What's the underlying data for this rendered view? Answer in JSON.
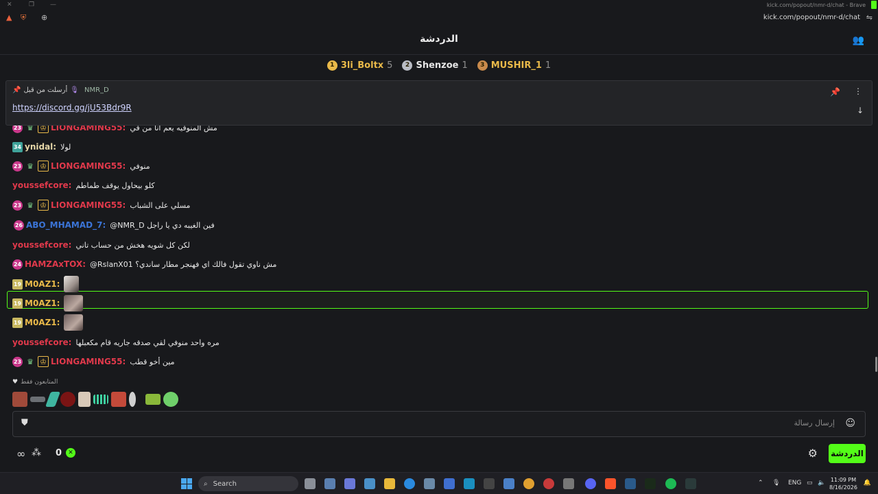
{
  "browser": {
    "title": "kick.com/popout/nmr-d/chat - Brave",
    "url": "kick.com/popout/nmr-d/chat"
  },
  "header": {
    "title": "الدردشة"
  },
  "leaderboard": [
    {
      "rank": "1",
      "name": "3li_Boltx",
      "count": "5",
      "color": "#e9b949",
      "name_color": "#e9b949"
    },
    {
      "rank": "2",
      "name": "Shenzoe",
      "count": "1",
      "color": "#b9bcc4",
      "name_color": "#e6e6e6"
    },
    {
      "rank": "3",
      "name": "MUSHIR_1",
      "count": "1",
      "color": "#c98a4b",
      "name_color": "#e9b949"
    }
  ],
  "pinned": {
    "label": "أرسلت من قبل",
    "author": "NMR_D",
    "link": "https://discord.gg/jU53Bdr9R"
  },
  "messages": [
    {
      "user": "LIONGAMING55",
      "color": "#e0394b",
      "badge": "23",
      "badge_color": "#c9378a",
      "extras": true,
      "text": "مش المنوفيه يعم انا من في"
    },
    {
      "user": "ynidal",
      "color": "#e6d7a8",
      "badge": "34",
      "badge_color": "#3fa39a",
      "extras": false,
      "text": "لولا"
    },
    {
      "user": "LIONGAMING55",
      "color": "#e0394b",
      "badge": "23",
      "badge_color": "#c9378a",
      "extras": true,
      "text": "منوفي"
    },
    {
      "user": "youssefcore",
      "color": "#e0394b",
      "badge": "",
      "badge_color": "",
      "extras": false,
      "text": "كلو بيحاول يوقف طماطم"
    },
    {
      "user": "LIONGAMING55",
      "color": "#e0394b",
      "badge": "23",
      "badge_color": "#c9378a",
      "extras": true,
      "text": "مسلي على الشباب"
    },
    {
      "user": "ABO_MHAMAD_7",
      "color": "#3b74d6",
      "badge": "26",
      "badge_color": "#c9378a",
      "extras": false,
      "text": "@NMR_D فين الغيبه دي يا راجل"
    },
    {
      "user": "youssefcore",
      "color": "#e0394b",
      "badge": "",
      "badge_color": "",
      "extras": false,
      "text": "لكن كل شويه هخش من حساب تاني"
    },
    {
      "user": "HAMZAxTOX",
      "color": "#e0394b",
      "badge": "24",
      "badge_color": "#c9378a",
      "extras": false,
      "text": "@RslanX01 مش ناوي تقول فالك اي فهنجر مطار ساندي؟"
    },
    {
      "user": "M0AZ1",
      "color": "#e9b949",
      "badge": "19",
      "badge_color": "#c8b860",
      "extras": false,
      "text": ""
    },
    {
      "user": "M0AZ1",
      "color": "#e9b949",
      "badge": "19",
      "badge_color": "#c8b860",
      "extras": false,
      "text": ""
    },
    {
      "user": "M0AZ1",
      "color": "#e9b949",
      "badge": "19",
      "badge_color": "#c8b860",
      "extras": false,
      "text": ""
    },
    {
      "user": "youssefcore",
      "color": "#e0394b",
      "badge": "",
      "badge_color": "",
      "extras": false,
      "text": "مره واحد منوفي لقي صدقه جاريه قام مكعبلها"
    },
    {
      "user": "LIONGAMING55",
      "color": "#e0394b",
      "badge": "23",
      "badge_color": "#c9378a",
      "extras": true,
      "text": "مين أخو قطب"
    }
  ],
  "watchers": {
    "label": "المتابعون فقط"
  },
  "input": {
    "placeholder": "إرسال رسالة"
  },
  "footer": {
    "count": "0",
    "chat_button": "الدردشة"
  },
  "taskbar": {
    "search": "Search",
    "lang": "ENG",
    "time": "11:09 PM",
    "date": "8/16/2026"
  },
  "colors": {
    "accent": "#53fc18",
    "bg": "#18191c"
  }
}
